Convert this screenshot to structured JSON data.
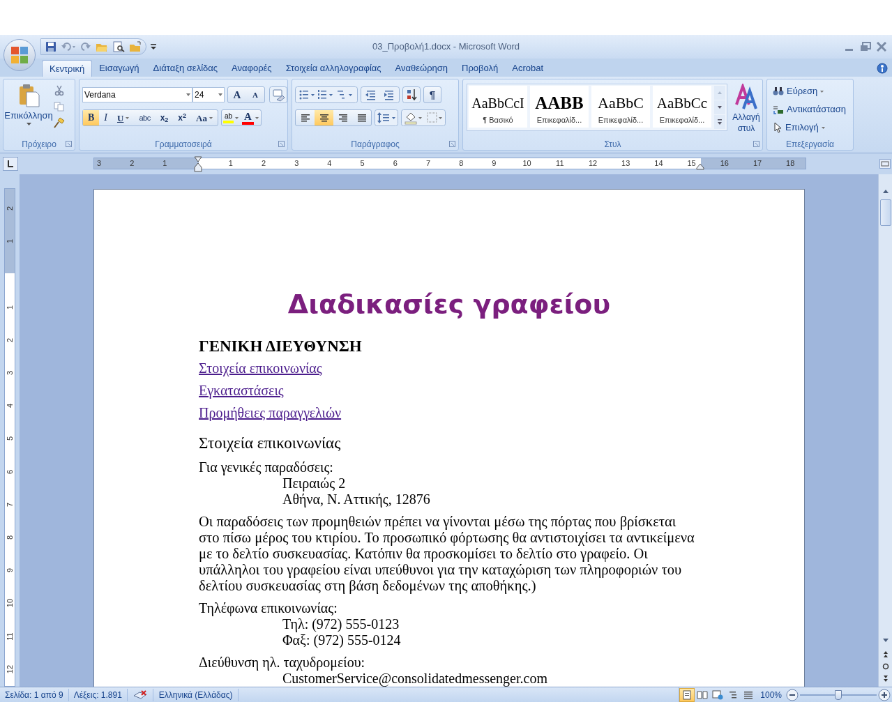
{
  "window": {
    "title": "03_Προβολή1.docx - Microsoft Word"
  },
  "tabs": [
    {
      "label": "Κεντρική",
      "selected": true
    },
    {
      "label": "Εισαγωγή",
      "selected": false
    },
    {
      "label": "Διάταξη σελίδας",
      "selected": false
    },
    {
      "label": "Αναφορές",
      "selected": false
    },
    {
      "label": "Στοιχεία αλληλογραφίας",
      "selected": false
    },
    {
      "label": "Αναθεώρηση",
      "selected": false
    },
    {
      "label": "Προβολή",
      "selected": false
    },
    {
      "label": "Acrobat",
      "selected": false
    }
  ],
  "clipboard": {
    "paste": "Επικόλληση",
    "group": "Πρόχειρο"
  },
  "font": {
    "name": "Verdana",
    "size": "24",
    "grow": "A",
    "shrink": "A",
    "group": "Γραμματοσειρά",
    "highlight": "ab",
    "font_color": "A",
    "buttons": [
      {
        "kind": "bold",
        "glyph": "B",
        "selected": true
      },
      {
        "kind": "italic",
        "glyph": "I",
        "selected": false
      },
      {
        "kind": "underline",
        "glyph": "U",
        "selected": false
      },
      {
        "kind": "strike",
        "glyph": "abc",
        "selected": false
      },
      {
        "kind": "sub",
        "glyph": "x$_{2}$",
        "selected": false
      },
      {
        "kind": "sup",
        "glyph": "x$^{2}$",
        "selected": false
      },
      {
        "kind": "case",
        "glyph": "Aa",
        "selected": false
      }
    ]
  },
  "paragraph": {
    "group": "Παράγραφος",
    "pilcrow": "¶",
    "alignment": [
      {
        "kind": "left",
        "selected": false
      },
      {
        "kind": "center",
        "selected": true
      },
      {
        "kind": "right",
        "selected": false
      },
      {
        "kind": "justify",
        "selected": false
      }
    ]
  },
  "styles": {
    "group": "Στυλ",
    "change": "Αλλαγή στυλ",
    "gallery": [
      {
        "kind": "normal",
        "sample": "AaBbCcI",
        "label": "¶ Βασικό"
      },
      {
        "kind": "heading1",
        "sample": "AABB",
        "label": "Επικεφαλίδ..."
      },
      {
        "kind": "heading2",
        "sample": "AaBbC",
        "label": "Επικεφαλίδ..."
      },
      {
        "kind": "heading3",
        "sample": "AaBbCc",
        "label": "Επικεφαλίδ..."
      }
    ]
  },
  "editing": {
    "group": "Επεξεργασία",
    "items": [
      {
        "kind": "find",
        "label": "Εύρεση",
        "dropdown": true
      },
      {
        "kind": "replace",
        "label": "Αντικατάσταση",
        "dropdown": false
      },
      {
        "kind": "select",
        "label": "Επιλογή",
        "dropdown": true
      }
    ]
  },
  "ruler": {
    "horizontal": [
      "3",
      "2",
      "1",
      "1",
      "2",
      "3",
      "4",
      "5",
      "6",
      "7",
      "8",
      "9",
      "10",
      "11",
      "12",
      "13",
      "14",
      "15",
      "16",
      "17",
      "18"
    ],
    "vertical": [
      "2",
      "1",
      "1",
      "2",
      "3",
      "4",
      "5",
      "6",
      "7",
      "8",
      "9",
      "10",
      "11",
      "12"
    ]
  },
  "document": [
    {
      "kind": "title",
      "text": "Διαδικασίες γραφείου"
    },
    {
      "kind": "heading",
      "text": "ΓΕΝΙΚΗ ΔΙΕΥΘΥΝΣΗ"
    },
    {
      "kind": "link",
      "text": "Στοιχεία επικοινωνίας"
    },
    {
      "kind": "link",
      "text": "Εγκαταστάσεις"
    },
    {
      "kind": "link",
      "text": "Προμήθειες παραγγελιών"
    },
    {
      "kind": "subheading",
      "text": "Στοιχεία επικοινωνίας"
    },
    {
      "kind": "label",
      "text": "Για γενικές παραδόσεις:"
    },
    {
      "kind": "indent",
      "text": "Πειραιώς 2"
    },
    {
      "kind": "indent",
      "text": "Αθήνα, Ν. Αττικής, 12876"
    },
    {
      "kind": "paragraph",
      "text": "Οι παραδόσεις των προμηθειών πρέπει να γίνονται μέσω της πόρτας που βρίσκεται στο πίσω μέρος του κτιρίου. Το προσωπικό φόρτωσης θα αντιστοιχίσει τα αντικείμενα με το δελτίο συσκευασίας. Κατόπιν θα προσκομίσει το δελτίο στο γραφείο.  Οι υπάλληλοι του γραφείου είναι υπεύθυνοι για την καταχώριση των πληροφοριών του δελτίου συσκευασίας στη βάση δεδομένων της αποθήκης.)"
    },
    {
      "kind": "label",
      "text": "Τηλέφωνα επικοινωνίας:"
    },
    {
      "kind": "indent",
      "text": "Τηλ: (972) 555-0123"
    },
    {
      "kind": "indent",
      "text": "Φαξ: (972) 555-0124"
    },
    {
      "kind": "label",
      "text": "Διεύθυνση ηλ. ταχυδρομείου:"
    },
    {
      "kind": "indent",
      "text": "CustomerService@consolidatedmessenger.com"
    }
  ],
  "status_bar": {
    "page": "Σελίδα: 1 από 9",
    "words": "Λέξεις: 1.891",
    "language": "Ελληνικά (Ελλάδας)",
    "zoom": "100%",
    "views": [
      {
        "kind": "print",
        "selected": true
      },
      {
        "kind": "reading",
        "selected": false
      },
      {
        "kind": "web",
        "selected": false
      },
      {
        "kind": "outline",
        "selected": false
      },
      {
        "kind": "draft",
        "selected": false
      }
    ],
    "zoom_slider": {
      "level": 0.5
    }
  }
}
